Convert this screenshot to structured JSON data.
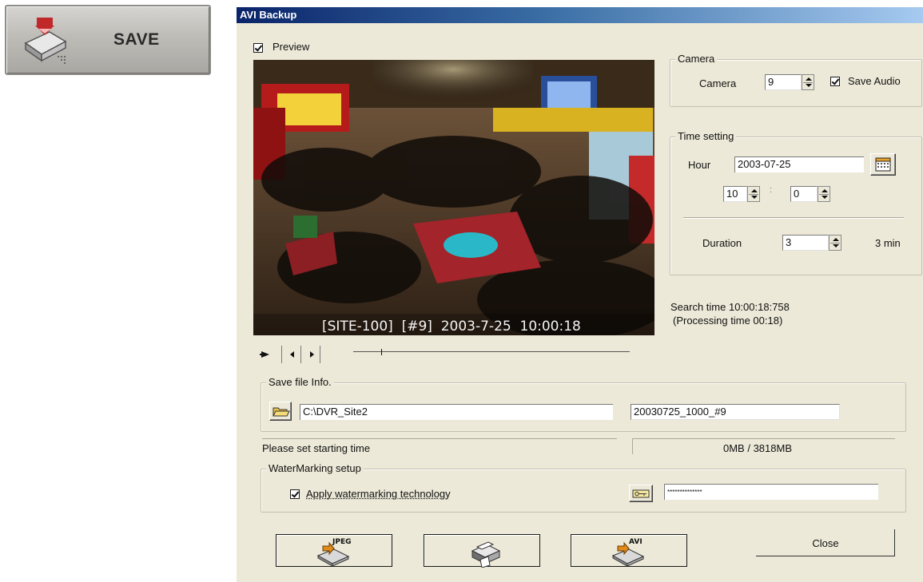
{
  "save_button": {
    "label": "SAVE"
  },
  "dialog": {
    "title": "AVI Backup",
    "preview_label": "Preview",
    "preview_checked": true,
    "video_overlay": "[SITE-100]  [#9]  2003-7-25  10:00:18",
    "camera_group": {
      "legend": "Camera",
      "camera_label": "Camera",
      "camera_value": "9",
      "save_audio_label": "Save Audio",
      "save_audio_checked": true
    },
    "time_group": {
      "legend": "Time setting",
      "hour_label": "Hour",
      "date_value": "2003-07-25",
      "hour_value": "10",
      "time_separator": ":",
      "minute_value": "0",
      "duration_label": "Duration",
      "duration_value": "3",
      "duration_text": "3 min"
    },
    "search_time": "Search time 10:00:18:758",
    "processing_time": "(Processing time 00:18)",
    "playback_position": 0.1,
    "save_file_group": {
      "legend": "Save file Info.",
      "path_value": "C:\\DVR_Site2",
      "filename_value": "20030725_1000_#9"
    },
    "status_message": "Please set starting time",
    "disk_usage": "0MB / 3818MB",
    "watermark_group": {
      "legend": "WaterMarking setup",
      "apply_label": "Apply watermarking technology",
      "apply_checked": true,
      "password_value": "**************"
    },
    "buttons": {
      "jpeg_label": "JPEG",
      "avi_label": "AVI",
      "close_label": "Close"
    }
  }
}
